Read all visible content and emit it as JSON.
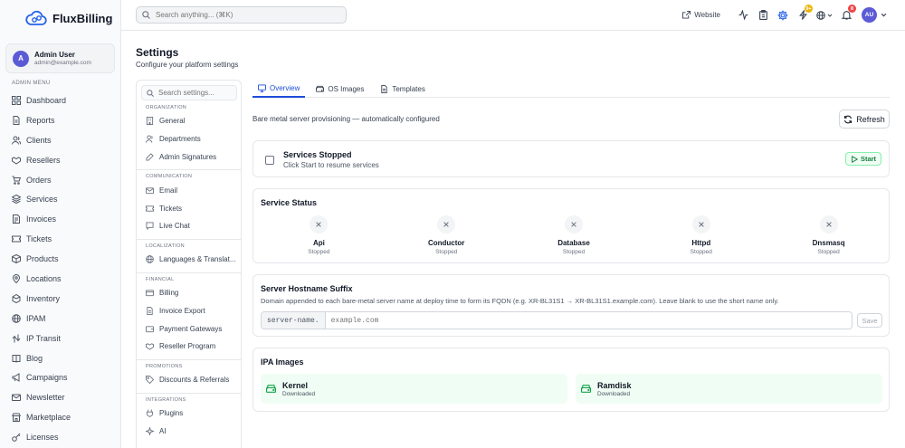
{
  "brand": {
    "name": "FluxBilling"
  },
  "user": {
    "initial": "A",
    "name": "Admin User",
    "email": "admin@example.com"
  },
  "sidebar": {
    "heading": "ADMIN MENU",
    "items": [
      {
        "label": "Dashboard",
        "icon": "grid-icon"
      },
      {
        "label": "Reports",
        "icon": "file-icon"
      },
      {
        "label": "Clients",
        "icon": "users-icon"
      },
      {
        "label": "Resellers",
        "icon": "handshake-icon"
      },
      {
        "label": "Orders",
        "icon": "cart-icon"
      },
      {
        "label": "Services",
        "icon": "layers-icon"
      },
      {
        "label": "Invoices",
        "icon": "invoice-icon"
      },
      {
        "label": "Tickets",
        "icon": "ticket-icon"
      },
      {
        "label": "Products",
        "icon": "box-icon"
      },
      {
        "label": "Locations",
        "icon": "pin-icon"
      },
      {
        "label": "Inventory",
        "icon": "package-icon"
      },
      {
        "label": "IPAM",
        "icon": "globe-icon"
      },
      {
        "label": "IP Transit",
        "icon": "route-icon"
      },
      {
        "label": "Blog",
        "icon": "book-icon"
      },
      {
        "label": "Campaigns",
        "icon": "megaphone-icon"
      },
      {
        "label": "Newsletter",
        "icon": "mail-icon"
      },
      {
        "label": "Marketplace",
        "icon": "store-icon"
      },
      {
        "label": "Licenses",
        "icon": "key-icon"
      }
    ]
  },
  "topbar": {
    "search_placeholder": "Search anything... (⌘K)",
    "website_label": "Website",
    "notifications_badge": "9+",
    "alerts_badge": "8",
    "avatar_initials": "AU",
    "colors": {
      "badge_yellow": "#eab308",
      "badge_red": "#ef4444",
      "accent": "#5b5bd6"
    }
  },
  "page": {
    "title": "Settings",
    "subtitle": "Configure your platform settings"
  },
  "settings_nav": {
    "search_placeholder": "Search settings...",
    "groups": [
      {
        "title": "ORGANIZATION",
        "items": [
          "General",
          "Departments",
          "Admin Signatures"
        ]
      },
      {
        "title": "COMMUNICATION",
        "items": [
          "Email",
          "Tickets",
          "Live Chat"
        ]
      },
      {
        "title": "LOCALIZATION",
        "items": [
          "Languages & Translat..."
        ]
      },
      {
        "title": "FINANCIAL",
        "items": [
          "Billing",
          "Invoice Export",
          "Payment Gateways",
          "Reseller Program"
        ]
      },
      {
        "title": "PROMOTIONS",
        "items": [
          "Discounts & Referrals"
        ]
      },
      {
        "title": "INTEGRATIONS",
        "items": [
          "Plugins",
          "AI"
        ]
      }
    ]
  },
  "tabs": [
    {
      "label": "Overview",
      "active": true
    },
    {
      "label": "OS Images",
      "active": false
    },
    {
      "label": "Templates",
      "active": false
    }
  ],
  "overview": {
    "description": "Bare metal server provisioning — automatically configured",
    "refresh_label": "Refresh",
    "services": {
      "title": "Services Stopped",
      "subtitle": "Click Start to resume services",
      "start_label": "Start"
    },
    "status": {
      "title": "Service Status",
      "items": [
        {
          "name": "Api",
          "state": "Stopped"
        },
        {
          "name": "Conductor",
          "state": "Stopped"
        },
        {
          "name": "Database",
          "state": "Stopped"
        },
        {
          "name": "Httpd",
          "state": "Stopped"
        },
        {
          "name": "Dnsmasq",
          "state": "Stopped"
        }
      ]
    },
    "hostname": {
      "title": "Server Hostname Suffix",
      "description": "Domain appended to each bare-metal server name at deploy time to form its FQDN (e.g. XR-BL31S1 → XR-BL31S1.example.com). Leave blank to use the short name only.",
      "prefix": "server-name.",
      "placeholder": "example.com",
      "save_label": "Save"
    },
    "ipa": {
      "title": "IPA Images",
      "items": [
        {
          "name": "Kernel",
          "state": "Downloaded"
        },
        {
          "name": "Ramdisk",
          "state": "Downloaded"
        }
      ]
    }
  }
}
